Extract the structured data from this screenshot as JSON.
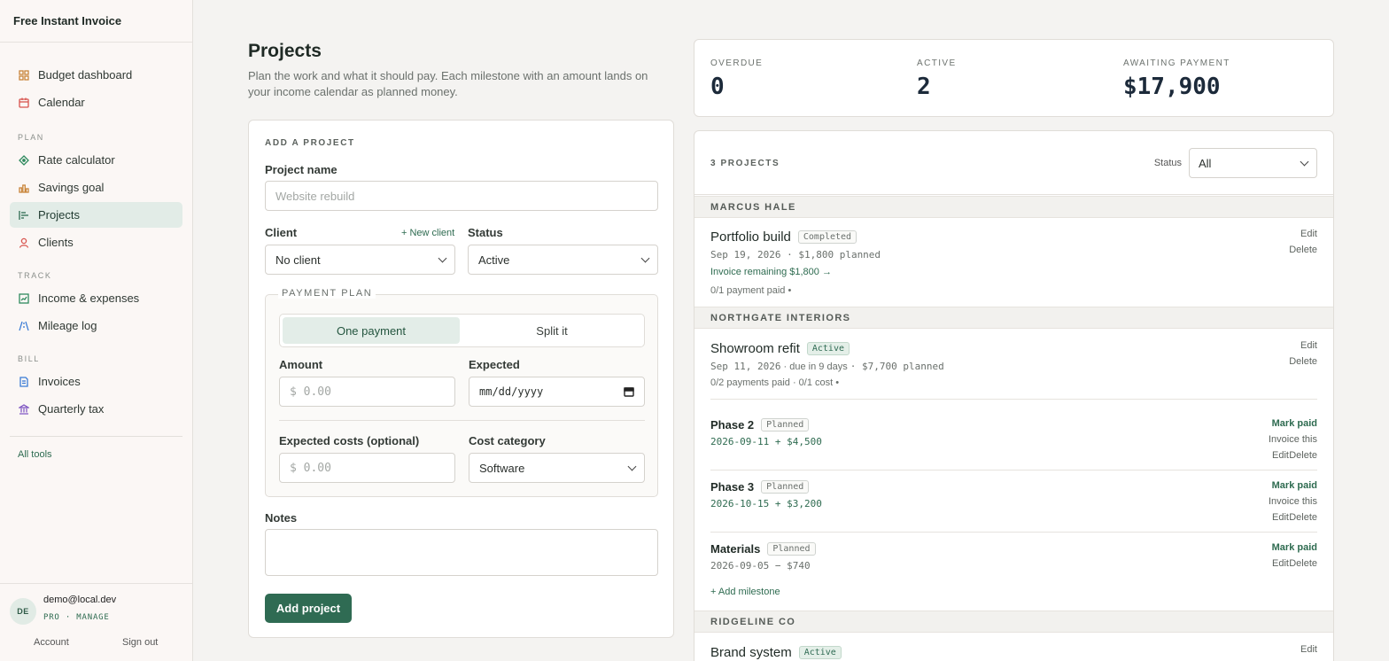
{
  "app": {
    "brand": "Free Instant Invoice"
  },
  "sidebar": {
    "top_items": [
      {
        "label": "Budget dashboard",
        "icon": "grid-icon"
      },
      {
        "label": "Calendar",
        "icon": "calendar-icon"
      }
    ],
    "sections": [
      {
        "title": "PLAN",
        "items": [
          {
            "label": "Rate calculator",
            "icon": "diamond-icon"
          },
          {
            "label": "Savings goal",
            "icon": "bar-chart-icon"
          },
          {
            "label": "Projects",
            "icon": "gantt-icon",
            "active": true
          },
          {
            "label": "Clients",
            "icon": "person-icon"
          }
        ]
      },
      {
        "title": "TRACK",
        "items": [
          {
            "label": "Income & expenses",
            "icon": "trend-icon"
          },
          {
            "label": "Mileage log",
            "icon": "road-icon"
          }
        ]
      },
      {
        "title": "BILL",
        "items": [
          {
            "label": "Invoices",
            "icon": "document-icon"
          },
          {
            "label": "Quarterly tax",
            "icon": "bank-icon"
          }
        ]
      }
    ],
    "all_tools": "All tools",
    "user": {
      "initials": "DE",
      "email": "demo@local.dev",
      "plan": "PRO · MANAGE",
      "account": "Account",
      "sign_out": "Sign out"
    }
  },
  "page": {
    "title": "Projects",
    "subtitle": "Plan the work and what it should pay. Each milestone with an amount lands on your income calendar as planned money."
  },
  "form": {
    "section_title": "ADD A PROJECT",
    "project_name_label": "Project name",
    "project_name_placeholder": "Website rebuild",
    "client_label": "Client",
    "new_client": "+ New client",
    "client_value": "No client",
    "status_label": "Status",
    "status_value": "Active",
    "payment_plan_legend": "PAYMENT PLAN",
    "one_payment": "One payment",
    "split_it": "Split it",
    "amount_label": "Amount",
    "amount_placeholder": "$ 0.00",
    "expected_label": "Expected",
    "expected_placeholder": "mm/dd/yyyy",
    "costs_label": "Expected costs (optional)",
    "costs_placeholder": "$ 0.00",
    "cost_category_label": "Cost category",
    "cost_category_value": "Software",
    "notes_label": "Notes",
    "submit": "Add project"
  },
  "stats": [
    {
      "label": "OVERDUE",
      "value": "0"
    },
    {
      "label": "ACTIVE",
      "value": "2"
    },
    {
      "label": "AWAITING PAYMENT",
      "value": "$17,900"
    }
  ],
  "list": {
    "count_label": "3 PROJECTS",
    "status_filter_label": "Status",
    "status_filter_value": "All",
    "groups": [
      {
        "client": "MARCUS HALE",
        "project": {
          "name": "Portfolio build",
          "badge": "Completed",
          "meta": "Sep 19, 2026 · $1,800 planned",
          "invoice_link": "Invoice remaining $1,800 →",
          "progress": "0/1 payment paid •",
          "edit": "Edit",
          "delete": "Delete"
        }
      },
      {
        "client": "NORTHGATE INTERIORS",
        "project": {
          "name": "Showroom refit",
          "badge": "Active",
          "meta_date": "Sep 11, 2026",
          "meta_due": " · due in 9 days ",
          "meta_planned": " · $7,700 planned",
          "progress": "0/2 payments paid · 0/1 cost •",
          "edit": "Edit",
          "delete": "Delete"
        },
        "milestones": [
          {
            "name": "Phase 2",
            "badge": "Planned",
            "line": "2026-09-11 + $4,500",
            "mark_paid": "Mark paid",
            "invoice": "Invoice this",
            "edit": "Edit",
            "delete": "Delete"
          },
          {
            "name": "Phase 3",
            "badge": "Planned",
            "line": "2026-10-15 + $3,200",
            "mark_paid": "Mark paid",
            "invoice": "Invoice this",
            "edit": "Edit",
            "delete": "Delete"
          },
          {
            "name": "Materials",
            "badge": "Planned",
            "line": "2026-09-05 − $740",
            "mark_paid": "Mark paid",
            "edit": "Edit",
            "delete": "Delete"
          }
        ],
        "add_milestone": "+ Add milestone"
      },
      {
        "client": "RIDGELINE CO",
        "project": {
          "name": "Brand system",
          "badge": "Active",
          "edit": "Edit"
        }
      }
    ]
  },
  "colors": {
    "accent": "#2f6b53",
    "sidebar_bg": "#fbf7f5",
    "page_bg": "#f4f3f1"
  }
}
